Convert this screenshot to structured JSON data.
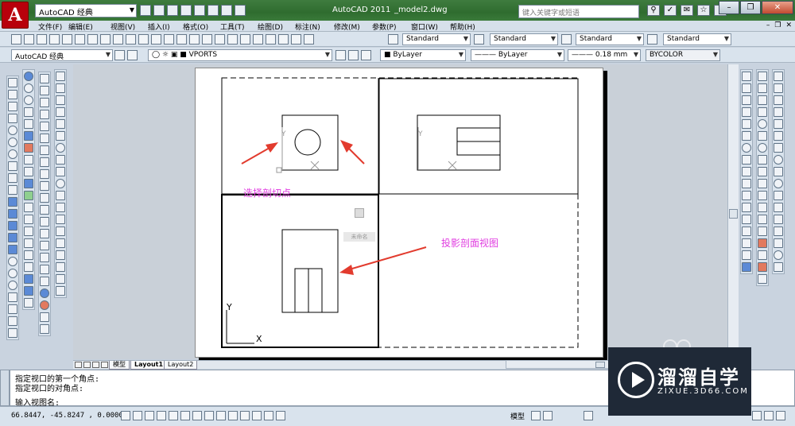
{
  "window": {
    "workspace": "AutoCAD 经典",
    "app_title": "AutoCAD 2011",
    "file_name": "_model2.dwg",
    "search_placeholder": "键入关键字或短语"
  },
  "menu": [
    "文件(F)",
    "编辑(E)",
    "视图(V)",
    "插入(I)",
    "格式(O)",
    "工具(T)",
    "绘图(D)",
    "标注(N)",
    "修改(M)",
    "参数(P)",
    "窗口(W)",
    "帮助(H)"
  ],
  "styles": {
    "text_style": "Standard",
    "dim_style": "Standard",
    "table_style": "Standard",
    "multileader_style": "Standard"
  },
  "layers": {
    "workspace": "AutoCAD 经典",
    "layer": "VPORTS",
    "color": "ByLayer",
    "linetype": "ByLayer",
    "lineweight": "0.18 mm",
    "plotstyle": "BYCOLOR"
  },
  "annotations": {
    "select_point": "选择剖切点",
    "projection_view": "投影剖面视图"
  },
  "viewport": {
    "name_tag": "未命名",
    "axis_y": "Y",
    "axis_x": "X"
  },
  "tabs": [
    "模型",
    "Layout1",
    "Layout2"
  ],
  "command_lines": [
    "指定视口的第一个角点:",
    "指定视口的对角点:",
    "输入视图名:"
  ],
  "status": {
    "coords": "66.8447,   -45.8247 , 0.0000",
    "model_label": "模型"
  },
  "watermark": {
    "title": "溜溜自学",
    "subtitle": "ZIXUE.3D66.COM"
  },
  "colors": {
    "annotation": "#e03de0",
    "arrow": "#e23b2e",
    "title_bar": "#3f7c3f"
  }
}
